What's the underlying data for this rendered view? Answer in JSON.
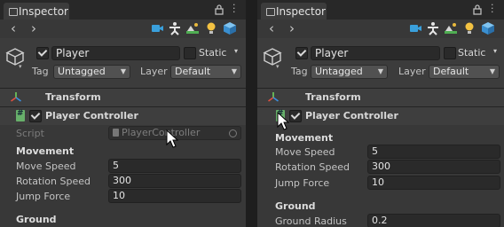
{
  "left": {
    "tab_title": "Inspector",
    "object_name": "Player",
    "static_label": "Static",
    "tag_label": "Tag",
    "tag_value": "Untagged",
    "layer_label": "Layer",
    "layer_value": "Default",
    "transform_label": "Transform",
    "component_label": "Player Controller",
    "script_label": "Script",
    "script_value": "PlayerController",
    "movement_header": "Movement",
    "fields": [
      {
        "label": "Move Speed",
        "value": "5"
      },
      {
        "label": "Rotation Speed",
        "value": "300"
      },
      {
        "label": "Jump Force",
        "value": "10"
      }
    ],
    "ground_header": "Ground"
  },
  "right": {
    "tab_title": "Inspector",
    "object_name": "Player",
    "static_label": "Static",
    "tag_label": "Tag",
    "tag_value": "Untagged",
    "layer_label": "Layer",
    "layer_value": "Default",
    "transform_label": "Transform",
    "component_label": "Player Controller",
    "movement_header": "Movement",
    "fields": [
      {
        "label": "Move Speed",
        "value": "5"
      },
      {
        "label": "Rotation Speed",
        "value": "300"
      },
      {
        "label": "Jump Force",
        "value": "10"
      }
    ],
    "ground_header": "Ground",
    "ground_radius": {
      "label": "Ground Radius",
      "value": "0.2"
    }
  },
  "icons": {
    "tab": "inspector-tab-icon",
    "lock": "lock-icon",
    "more": "more-options-icon",
    "back": "back-arrow-icon",
    "forward": "forward-arrow-icon",
    "camera": "camera-icon",
    "person": "person-icon",
    "landscape": "landscape-icon",
    "light": "light-icon",
    "package": "package-icon",
    "gameobject": "gameobject-cube-icon",
    "transform": "transform-icon",
    "script": "script-icon",
    "cursor": "mouse-cursor"
  },
  "colors": {
    "panel_bg": "#383838",
    "header_bg": "#3c3c3c",
    "field_bg": "#2a2a2a",
    "accent_blue": "#3aa0dc"
  }
}
